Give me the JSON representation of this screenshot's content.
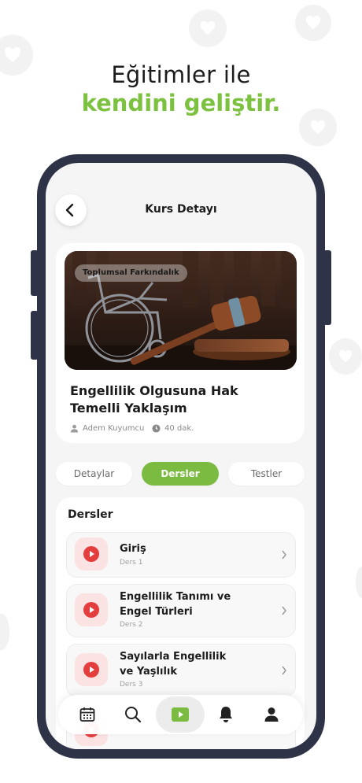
{
  "headline": {
    "line1": "Eğitimler ile",
    "line2": "kendini geliştir."
  },
  "header": {
    "title": "Kurs Detayı"
  },
  "course": {
    "category_tag": "Toplumsal Farkındalık",
    "title_line1": "Engellilik Olgusuna Hak",
    "title_line2": "Temelli Yaklaşım",
    "instructor": "Adem Kuyumcu",
    "duration": "40 dak."
  },
  "tabs": [
    {
      "label": "Detaylar",
      "active": false
    },
    {
      "label": "Dersler",
      "active": true
    },
    {
      "label": "Testler",
      "active": false
    }
  ],
  "lessons": {
    "heading": "Dersler",
    "items": [
      {
        "title_line1": "Giriş",
        "title_line2": "",
        "subtitle": "Ders 1"
      },
      {
        "title_line1": "Engellilik Tanımı ve",
        "title_line2": "Engel Türleri",
        "subtitle": "Ders 2"
      },
      {
        "title_line1": "Sayılarla Engellilik",
        "title_line2": "ve Yaşlılık",
        "subtitle": "Ders 3"
      }
    ]
  },
  "bottom_nav": {
    "items": [
      "calendar-icon",
      "search-icon",
      "play-icon",
      "bell-icon",
      "profile-icon"
    ],
    "active": "play-icon"
  },
  "colors": {
    "accent_green": "#7cbb42",
    "phone_frame": "#2e3347",
    "play_red": "#e43d3d"
  }
}
